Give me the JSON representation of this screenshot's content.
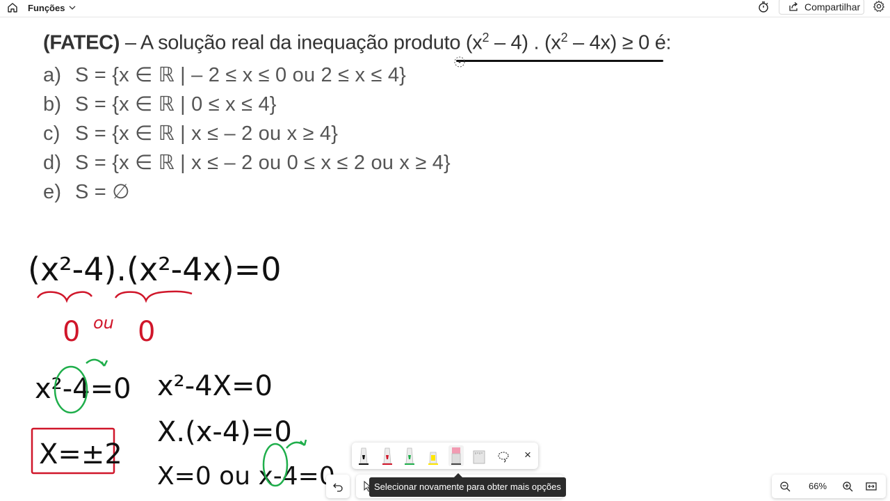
{
  "topbar": {
    "menu_label": "Funções",
    "share_label": "Compartilhar",
    "icons": [
      "home-icon",
      "chevron-down-icon",
      "timer-icon",
      "share-icon",
      "settings-icon"
    ]
  },
  "question": {
    "source": "(FATEC)",
    "stem": " – A solução real da inequação produto (x",
    "exp1": "2",
    "mid": " – 4) . (x",
    "exp2": "2",
    "tail": " – 4x) ≥ 0 é:",
    "options": [
      {
        "letter": "a)",
        "text": "S = {x ∈ ℝ | – 2 ≤ x ≤ 0 ou 2 ≤ x ≤ 4}"
      },
      {
        "letter": "b)",
        "text": "S = {x ∈ ℝ | 0 ≤ x ≤ 4}"
      },
      {
        "letter": "c)",
        "text": "S = {x ∈ ℝ | x ≤ – 2 ou x ≥ 4}"
      },
      {
        "letter": "d)",
        "text": "S = {x ∈ ℝ | x ≤ – 2 ou 0 ≤ x ≤ 2 ou x ≥ 4}"
      },
      {
        "letter": "e)",
        "text": "S = ∅"
      }
    ]
  },
  "handwriting": {
    "line1": "(x²-4).(x²-4x)=0",
    "under_left": "0",
    "under_ou": "ou",
    "under_right": "0",
    "eq_left": "x²-4=0",
    "result_left": "X=±2",
    "eq_right1": "x²-4X=0",
    "eq_right2": "X.(x-4)=0",
    "eq_right3": "X=0 ou x-4=0",
    "colors": {
      "ink": "#111111",
      "red": "#d0162a",
      "green": "#1fae4b"
    }
  },
  "toolbar": {
    "pens": [
      "black-pen-icon",
      "red-pen-icon",
      "green-pen-icon",
      "yellow-highlighter-icon",
      "pink-eraser-icon",
      "ruler-icon",
      "lasso-icon"
    ],
    "close_label": "×",
    "more_label": "···",
    "tooltip": "Selecionar novamente para obter mais opções"
  },
  "zoom": {
    "value": "66%"
  }
}
